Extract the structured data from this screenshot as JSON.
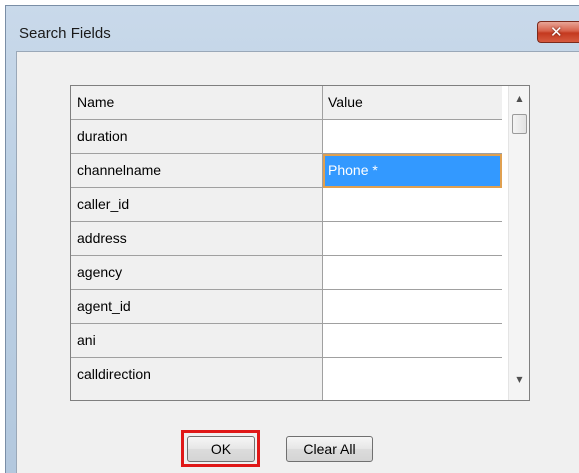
{
  "window": {
    "title": "Search Fields",
    "close_icon": "close-icon"
  },
  "grid": {
    "columns": [
      "Name",
      "Value"
    ],
    "rows": [
      {
        "name": "duration",
        "value": ""
      },
      {
        "name": "channelname",
        "value": "Phone *"
      },
      {
        "name": "caller_id",
        "value": ""
      },
      {
        "name": "address",
        "value": ""
      },
      {
        "name": "agency",
        "value": ""
      },
      {
        "name": "agent_id",
        "value": ""
      },
      {
        "name": "ani",
        "value": ""
      },
      {
        "name": "calldirection",
        "value": ""
      }
    ],
    "selected_row": 1
  },
  "buttons": {
    "ok_label": "OK",
    "clear_label": "Clear All"
  },
  "colors": {
    "selection": "#3399ff",
    "selection_border": "#e0a050",
    "highlight": "#e01818"
  }
}
